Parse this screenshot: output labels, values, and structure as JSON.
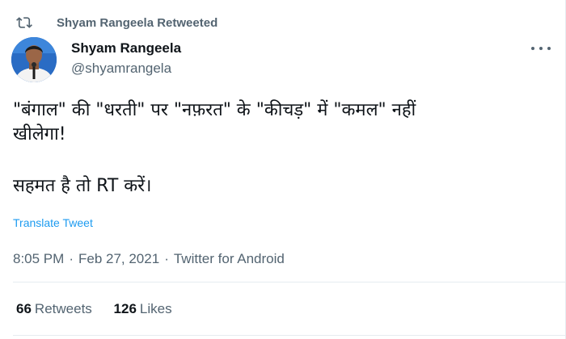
{
  "retweet_banner": {
    "icon": "retweet-icon",
    "text": "Shyam Rangeela Retweeted"
  },
  "author": {
    "display_name": "Shyam Rangeela",
    "handle": "@shyamrangela",
    "avatar": "profile-photo"
  },
  "tweet": {
    "lines": [
      "\"बंगाल\" की \"धरती\" पर \"नफ़रत\" के \"कीचड़\" में \"कमल\" नहीं",
      "खीलेगा!",
      "सहमत है तो RT करें।"
    ]
  },
  "translate_label": "Translate Tweet",
  "meta": {
    "time": "8:05 PM",
    "separator": "·",
    "date": "Feb 27, 2021",
    "source": "Twitter for Android"
  },
  "stats": {
    "retweets_count": "66",
    "retweets_label": "Retweets",
    "likes_count": "126",
    "likes_label": "Likes"
  },
  "colors": {
    "secondary_text": "#536471",
    "link": "#1d9bf0",
    "divider": "#e6ecf0"
  }
}
